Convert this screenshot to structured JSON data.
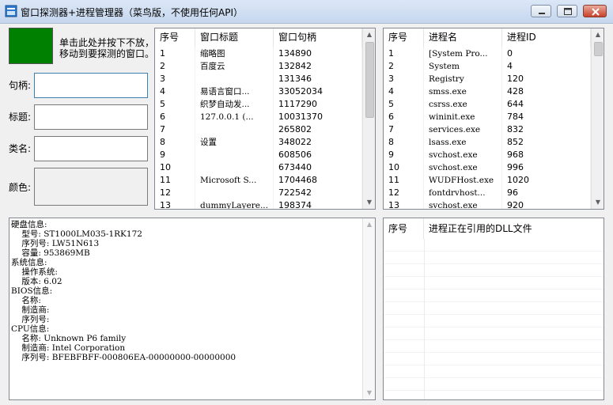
{
  "window": {
    "title": "窗口探测器+进程管理器（菜鸟版，不使用任何API）",
    "icon": "app-window-icon"
  },
  "probe": {
    "hint_line1": "单击此处并按下不放，",
    "hint_line2": "移动到要探测的窗口。",
    "swatch_color": "#008000",
    "labels": {
      "handle": "句柄:",
      "title": "标题:",
      "class": "类名:",
      "color": "颜色:"
    },
    "values": {
      "handle": "",
      "title": "",
      "class": "",
      "color": ""
    }
  },
  "windows_list": {
    "columns": [
      "序号",
      "窗口标题",
      "窗口句柄"
    ],
    "rows": [
      [
        "1",
        "缩略图",
        "134890"
      ],
      [
        "2",
        "百度云",
        "132842"
      ],
      [
        "3",
        "",
        "131346"
      ],
      [
        "4",
        "易语言窗口...",
        "33052034"
      ],
      [
        "5",
        "织梦自动发...",
        "1117290"
      ],
      [
        "6",
        "127.0.0.1 (...",
        "10031370"
      ],
      [
        "7",
        "",
        "265802"
      ],
      [
        "8",
        "设置",
        "348022"
      ],
      [
        "9",
        "",
        "608506"
      ],
      [
        "10",
        "",
        "673440"
      ],
      [
        "11",
        "Microsoft S...",
        "1704468"
      ],
      [
        "12",
        "",
        "722542"
      ],
      [
        "13",
        "dummyLayere...",
        "198374"
      ]
    ]
  },
  "process_list": {
    "columns": [
      "序号",
      "进程名",
      "进程ID"
    ],
    "rows": [
      [
        "1",
        "[System Pro...",
        "0"
      ],
      [
        "2",
        "System",
        "4"
      ],
      [
        "3",
        "Registry",
        "120"
      ],
      [
        "4",
        "smss.exe",
        "428"
      ],
      [
        "5",
        "csrss.exe",
        "644"
      ],
      [
        "6",
        "wininit.exe",
        "784"
      ],
      [
        "7",
        "services.exe",
        "832"
      ],
      [
        "8",
        "lsass.exe",
        "852"
      ],
      [
        "9",
        "svchost.exe",
        "968"
      ],
      [
        "10",
        "svchost.exe",
        "996"
      ],
      [
        "11",
        "WUDFHost.exe",
        "1020"
      ],
      [
        "12",
        "fontdrvhost...",
        "96"
      ],
      [
        "13",
        "svchost.exe",
        "920"
      ]
    ]
  },
  "sysinfo": {
    "lines": [
      "硬盘信息:",
      "    型号: ST1000LM035-1RK172",
      "    序列号: LW51N613",
      "    容量: 953869MB",
      "系统信息:",
      "    操作系统:",
      "    版本: 6.02",
      "BIOS信息:",
      "    名称:",
      "    制造商:",
      "    序列号:",
      "CPU信息:",
      "    名称: Unknown P6 family",
      "    制造商: Intel Corporation",
      "    序列号: BFEBFBFF-000806EA-00000000-00000000"
    ]
  },
  "dll_list": {
    "columns": [
      "序号",
      "进程正在引用的DLL文件"
    ],
    "rows": []
  }
}
